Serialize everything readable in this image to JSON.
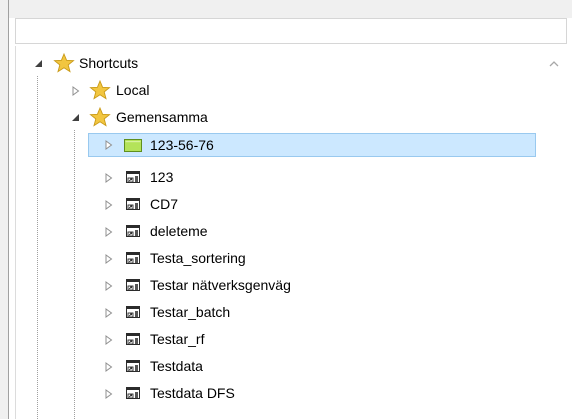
{
  "tree": {
    "root": {
      "label": "Shortcuts",
      "expanded": true,
      "icon": "star-icon"
    },
    "groups": [
      {
        "label": "Local",
        "expanded": false,
        "icon": "star-icon"
      },
      {
        "label": "Gemensamma",
        "expanded": true,
        "icon": "star-icon",
        "children": [
          {
            "label": "123-56-76",
            "icon": "green-folder-icon",
            "selected": true
          },
          {
            "label": "123",
            "icon": "shortcut-icon"
          },
          {
            "label": "CD7",
            "icon": "shortcut-icon"
          },
          {
            "label": "deleteme",
            "icon": "shortcut-icon"
          },
          {
            "label": "Testa_sortering",
            "icon": "shortcut-icon"
          },
          {
            "label": "Testar nätverksgenväg",
            "icon": "shortcut-icon"
          },
          {
            "label": "Testar_batch",
            "icon": "shortcut-icon"
          },
          {
            "label": "Testar_rf",
            "icon": "shortcut-icon"
          },
          {
            "label": "Testdata",
            "icon": "shortcut-icon"
          },
          {
            "label": "Testdata DFS",
            "icon": "shortcut-icon"
          }
        ]
      }
    ]
  },
  "colors": {
    "selection_fill": "#cce8ff",
    "selection_border": "#99c9ef",
    "star": "#f2c640",
    "folder_green": "#b4e35a"
  }
}
